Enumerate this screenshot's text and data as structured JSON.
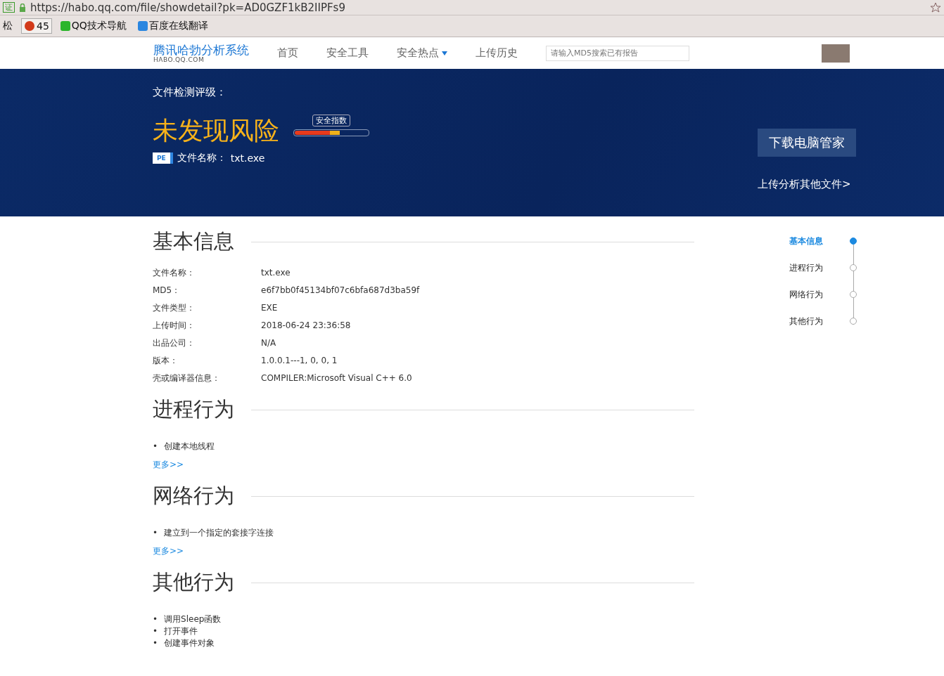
{
  "browser": {
    "url": "https://habo.qq.com/file/showdetail?pk=AD0GZF1kB2IIPFs9",
    "cert_badge": "证",
    "bookmarks": [
      {
        "label": "松",
        "kind": "plain"
      },
      {
        "label": "45",
        "kind": "avatar"
      },
      {
        "label": "QQ技术导航",
        "kind": "guide"
      },
      {
        "label": "百度在线翻译",
        "kind": "translate"
      }
    ]
  },
  "header": {
    "logo": "腾讯哈勃分析系统",
    "logo_sub": "HABO.QQ.COM",
    "nav": [
      {
        "label": "首页",
        "dropdown": false
      },
      {
        "label": "安全工具",
        "dropdown": false
      },
      {
        "label": "安全热点",
        "dropdown": true
      },
      {
        "label": "上传历史",
        "dropdown": false
      }
    ],
    "search": {
      "placeholder": "请输入MD5搜索已有报告"
    }
  },
  "banner": {
    "heading": "文件检测评级：",
    "verdict": "未发现风险",
    "meter": {
      "label": "安全指数",
      "level": 0.62
    },
    "file_badge": "PE",
    "file_label": "文件名称：",
    "file_name": "txt.exe",
    "download_button": "下载电脑管家",
    "upload_link": "上传分析其他文件>"
  },
  "sections": [
    {
      "title": "基本信息",
      "kind": "table",
      "rows": [
        {
          "label": "文件名称：",
          "value": "txt.exe"
        },
        {
          "label": "MD5：",
          "value": "e6f7bb0f45134bf07c6bfa687d3ba59f"
        },
        {
          "label": "文件类型：",
          "value": "EXE"
        },
        {
          "label": "上传时间：",
          "value": "2018-06-24 23:36:58"
        },
        {
          "label": "出品公司：",
          "value": "N/A"
        },
        {
          "label": "版本：",
          "value": "1.0.0.1---1, 0, 0, 1"
        },
        {
          "label": "壳或编译器信息：",
          "value": "COMPILER:Microsoft Visual C++ 6.0"
        }
      ]
    },
    {
      "title": "进程行为",
      "kind": "list",
      "items": [
        {
          "marker": "•",
          "text": "创建本地线程"
        }
      ],
      "more": "更多>>"
    },
    {
      "title": "网络行为",
      "kind": "list",
      "items": [
        {
          "marker": "•",
          "text": "建立到一个指定的套接字连接"
        }
      ],
      "more": "更多>>"
    },
    {
      "title": "其他行为",
      "kind": "list",
      "items": [
        {
          "marker": "•",
          "text": "调用Sleep函数"
        },
        {
          "marker": "•",
          "text": "打开事件"
        },
        {
          "marker": "•",
          "text": "创建事件对象"
        }
      ]
    }
  ],
  "side_nav": [
    {
      "label": "基本信息",
      "selected": true
    },
    {
      "label": "进程行为",
      "selected": false
    },
    {
      "label": "网络行为",
      "selected": false
    },
    {
      "label": "其他行为",
      "selected": false
    }
  ]
}
